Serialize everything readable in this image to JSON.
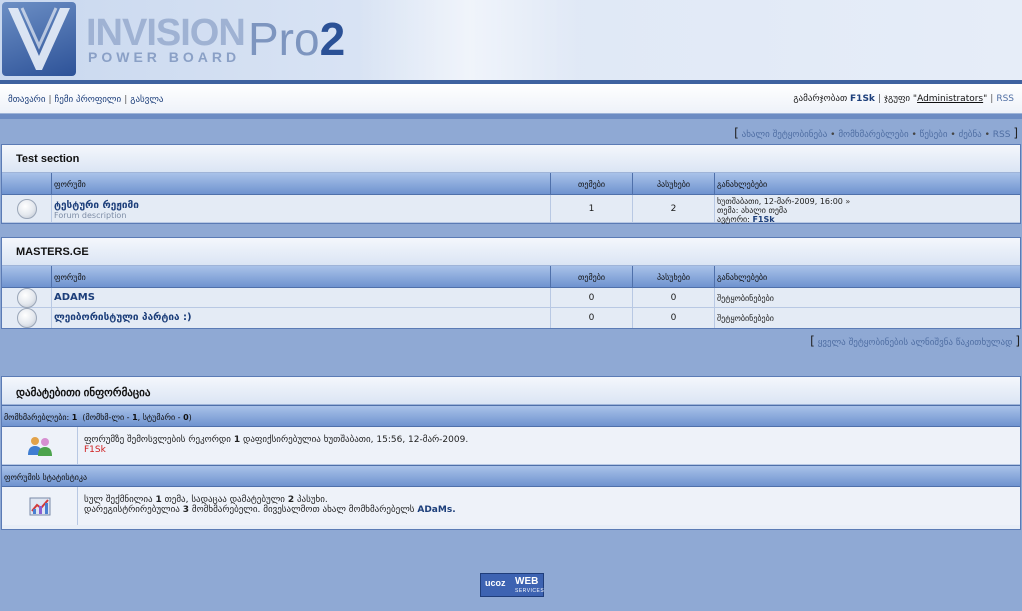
{
  "logo": {
    "line1": "INVISION",
    "line2": "POWER BOARD",
    "pro": "Pro",
    "version": "2"
  },
  "userbar": {
    "links": [
      "მთავარი",
      "ჩემი პროფილი",
      "გასვლა"
    ],
    "greeting": "გამარჯობათ",
    "username": "F1Sk",
    "group_prefix": "ჯგუფი \"",
    "group": "Administrators",
    "group_suffix": "\"",
    "rss": "RSS"
  },
  "quicklinks": [
    "ახალი შეტყობინება",
    "მომხმარებლები",
    "წესები",
    "ძებნა",
    "RSS"
  ],
  "columns": {
    "forum": "ფორუმი",
    "topics": "თემები",
    "replies": "პასუხები",
    "last_post": "განახლებები"
  },
  "categories": [
    {
      "title": "Test section",
      "forums": [
        {
          "name": "ტესტური რეჟიმი",
          "description": "Forum description",
          "topics": "1",
          "replies": "2",
          "last_line1": "ხუთშაბათი, 12-მარ-2009, 16:00",
          "last_arrow": "»",
          "last_line2": "თემა: ახალი თემა",
          "last_author_label": "ავტორი:",
          "last_author": "F1Sk"
        }
      ]
    },
    {
      "title": "MASTERS.GE",
      "forums": [
        {
          "name": "ADAMS",
          "topics": "0",
          "replies": "0",
          "last_line1": "შეტყობინებები"
        },
        {
          "name": "ლეიბორისტული პარტია :)",
          "topics": "0",
          "replies": "0",
          "last_line1": "შეტყობინებები"
        }
      ]
    }
  ],
  "mark_all_read": "ყველა შეტყობინების ალნიშვნა წაკითხულად",
  "stats": {
    "title": "დამატებითი ინფორმაცია",
    "online_bar": {
      "label": "მომხმარებლები:",
      "count": "1",
      "detail_pre": "(მომხმ-ლი -",
      "members": "1",
      "detail_mid": ", სტუმარი -",
      "guests": "0",
      "detail_post": ")"
    },
    "record_text_pre": "ფორუმზე შემოსვლების რეკორდი",
    "record_count": "1",
    "record_text_post": "დაფიქსირებულია ხუთშაბათი, 15:56, 12-მარ-2009.",
    "online_user": "F1Sk",
    "forum_stats_bar": "ფორუმის სტატისტიკა",
    "totals_pre": "სულ შექმნილია",
    "totals_topics": "1",
    "totals_mid": "თემა, სადაცაა დამატებული",
    "totals_replies": "2",
    "totals_post": "პასუხი.",
    "reg_pre": "დარეგისტრირებულია",
    "reg_count": "3",
    "reg_post": "მომხმარებელი. მივესალმოთ ახალ მომხმარებელს",
    "newest_member": "ADaMs."
  },
  "footer_badge": {
    "left": "ucoz",
    "right1": "WEB",
    "right2": "SERVICES"
  }
}
